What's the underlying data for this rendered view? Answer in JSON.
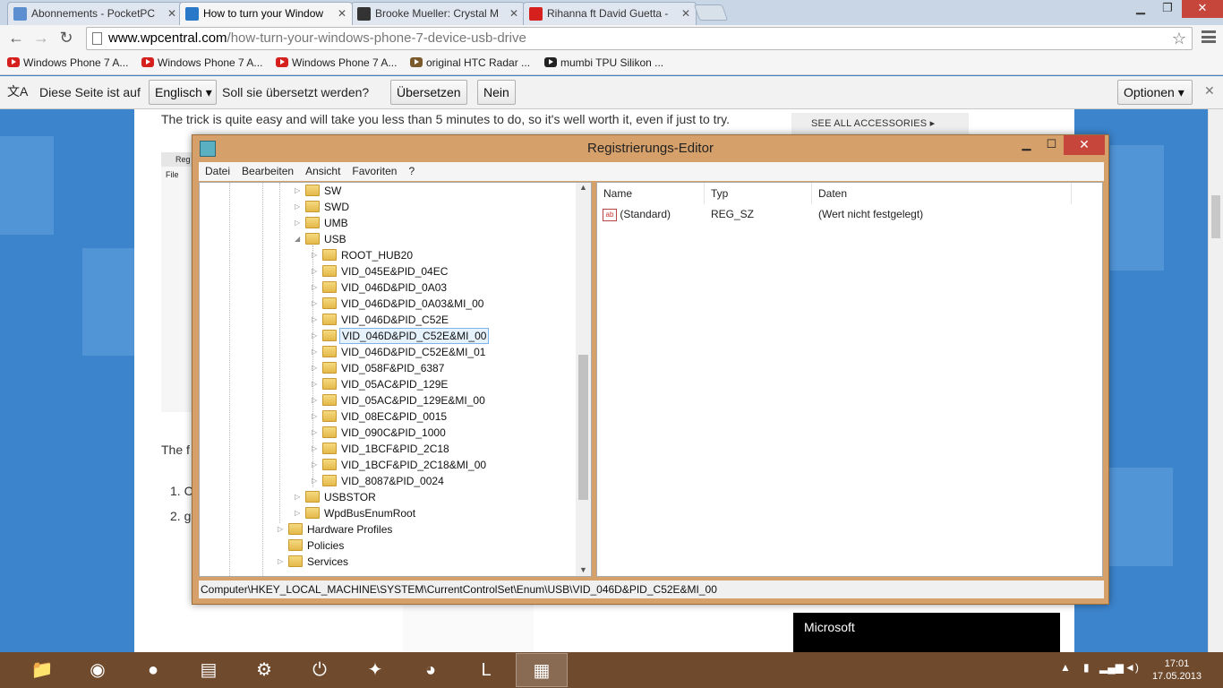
{
  "browser": {
    "tabs": [
      {
        "title": "Abonnements - PocketPC",
        "color": "#5b8fd0"
      },
      {
        "title": "How to turn your Window",
        "color": "#2a79c8"
      },
      {
        "title": "Brooke Mueller: Crystal M",
        "color": "#333333"
      },
      {
        "title": "Rihanna ft David Guetta -",
        "color": "#d6201e"
      }
    ],
    "url_host": "www.wpcentral.com",
    "url_path": "/how-turn-your-windows-phone-7-device-usb-drive",
    "bookmarks": [
      "Windows Phone 7 A...",
      "Windows Phone 7 A...",
      "Windows Phone 7 A...",
      "original HTC Radar ...",
      "mumbi TPU Silikon ..."
    ]
  },
  "translate": {
    "prefix": "Diese Seite ist auf",
    "language": "Englisch",
    "question": "Soll sie übersetzt werden?",
    "translate_btn": "Übersetzen",
    "no_btn": "Nein",
    "options_btn": "Optionen"
  },
  "article": {
    "lead": "The trick is quite easy and will take you less than 5 minutes to do, so it's well worth it, even if just to try.",
    "see_all": "SEE ALL ACCESSORIES ▸",
    "snip_the": "The f",
    "list1": "1.  C",
    "list2": "2.  g",
    "thumb_reg": "Reg",
    "thumb_file": "File",
    "microsoft": "Microsoft"
  },
  "regedit": {
    "title": "Registrierungs-Editor",
    "menu": [
      "Datei",
      "Bearbeiten",
      "Ansicht",
      "Favoriten",
      "?"
    ],
    "tree": {
      "top_level": [
        "SW",
        "SWD",
        "UMB",
        "USB"
      ],
      "usb_children": [
        "ROOT_HUB20",
        "VID_045E&PID_04EC",
        "VID_046D&PID_0A03",
        "VID_046D&PID_0A03&MI_00",
        "VID_046D&PID_C52E",
        "VID_046D&PID_C52E&MI_00",
        "VID_046D&PID_C52E&MI_01",
        "VID_058F&PID_6387",
        "VID_05AC&PID_129E",
        "VID_05AC&PID_129E&MI_00",
        "VID_08EC&PID_0015",
        "VID_090C&PID_1000",
        "VID_1BCF&PID_2C18",
        "VID_1BCF&PID_2C18&MI_00",
        "VID_8087&PID_0024"
      ],
      "after_usb": [
        "USBSTOR",
        "WpdBusEnumRoot"
      ],
      "parent_level": [
        "Hardware Profiles",
        "Policies",
        "Services"
      ],
      "selected": "VID_046D&PID_C52E&MI_00"
    },
    "columns": [
      "Name",
      "Typ",
      "Daten"
    ],
    "values": [
      {
        "name": "(Standard)",
        "type": "REG_SZ",
        "data": "(Wert nicht festgelegt)"
      }
    ],
    "status_path": "Computer\\HKEY_LOCAL_MACHINE\\SYSTEM\\CurrentControlSet\\Enum\\USB\\VID_046D&PID_C52E&MI_00"
  },
  "taskbar": {
    "time": "17:01",
    "date": "17.05.2013"
  }
}
